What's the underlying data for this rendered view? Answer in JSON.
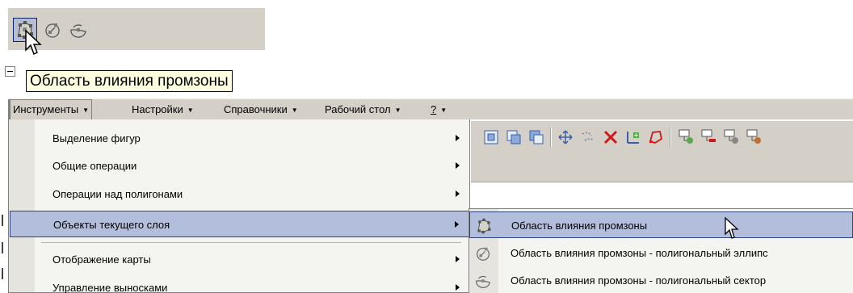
{
  "top_toolbar": {
    "buttons": [
      {
        "icon": "promzone-area-icon",
        "pressed": true
      },
      {
        "icon": "polygon-ellipse-icon",
        "pressed": false
      },
      {
        "icon": "polygon-sector-icon",
        "pressed": false
      }
    ]
  },
  "tooltip": "Область влияния промзоны",
  "menubar": {
    "items": [
      {
        "label": "Инструменты",
        "open": true
      },
      {
        "label": "Настройки",
        "open": false
      },
      {
        "label": "Справочники",
        "open": false
      },
      {
        "label": "Рабочий стол",
        "open": false
      },
      {
        "label": "?",
        "open": false
      }
    ]
  },
  "dropdown": {
    "items": [
      {
        "label": "Выделение фигур",
        "has_submenu": true
      },
      {
        "label": "Общие операции",
        "has_submenu": true
      },
      {
        "label": "Операции над полигонами",
        "has_submenu": true
      },
      {
        "label": "Объекты текущего слоя",
        "has_submenu": true,
        "highlighted": true
      },
      {
        "label": "Отображение карты",
        "has_submenu": true
      },
      {
        "label": "Управление выносками",
        "has_submenu": true
      }
    ]
  },
  "submenu": {
    "items": [
      {
        "label": "Область влияния промзоны",
        "icon": "promzone-area-icon",
        "highlighted": true
      },
      {
        "label": "Область влияния промзоны - полигональный эллипс",
        "icon": "polygon-ellipse-icon"
      },
      {
        "label": "Область влияния промзоны - полигональный сектор",
        "icon": "polygon-sector-icon"
      }
    ]
  },
  "colors": {
    "menu_highlight": "#b3bedc",
    "highlight_border": "#30437a",
    "tooltip_bg": "#ffffe1",
    "toolbar_bg": "#d4d0c8"
  }
}
